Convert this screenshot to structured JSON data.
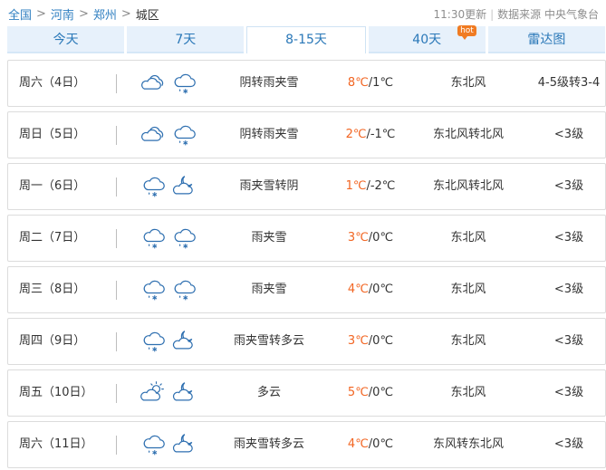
{
  "breadcrumb": {
    "items": [
      "全国",
      "河南",
      "郑州",
      "城区"
    ]
  },
  "meta": {
    "update_time": "11:30更新",
    "source": "数据来源 中央气象台"
  },
  "tabs": [
    {
      "label": "今天"
    },
    {
      "label": "7天"
    },
    {
      "label": "8-15天",
      "active": true
    },
    {
      "label": "40天",
      "badge": "hot"
    },
    {
      "label": "雷达图"
    }
  ],
  "forecast": [
    {
      "day": "周六（4日）",
      "icon_day": "cloudy-icon",
      "icon_night": "sleet-icon",
      "desc": "阴转雨夹雪",
      "hi": "8℃",
      "lo": "/1℃",
      "wind": "东北风",
      "level": "4-5级转3-4"
    },
    {
      "day": "周日（5日）",
      "icon_day": "cloudy-icon",
      "icon_night": "sleet-icon",
      "desc": "阴转雨夹雪",
      "hi": "2℃",
      "lo": "/-1℃",
      "wind": "东北风转北风",
      "level": "<3级"
    },
    {
      "day": "周一（6日）",
      "icon_day": "sleet-icon",
      "icon_night": "moon-cloud-icon",
      "desc": "雨夹雪转阴",
      "hi": "1℃",
      "lo": "/-2℃",
      "wind": "东北风转北风",
      "level": "<3级"
    },
    {
      "day": "周二（7日）",
      "icon_day": "sleet-icon",
      "icon_night": "sleet-icon",
      "desc": "雨夹雪",
      "hi": "3℃",
      "lo": "/0℃",
      "wind": "东北风",
      "level": "<3级"
    },
    {
      "day": "周三（8日）",
      "icon_day": "sleet-icon",
      "icon_night": "sleet-icon",
      "desc": "雨夹雪",
      "hi": "4℃",
      "lo": "/0℃",
      "wind": "东北风",
      "level": "<3级"
    },
    {
      "day": "周四（9日）",
      "icon_day": "sleet-icon",
      "icon_night": "moon-cloud-icon",
      "desc": "雨夹雪转多云",
      "hi": "3℃",
      "lo": "/0℃",
      "wind": "东北风",
      "level": "<3级"
    },
    {
      "day": "周五（10日）",
      "icon_day": "sun-cloud-icon",
      "icon_night": "moon-cloud-icon",
      "desc": "多云",
      "hi": "5℃",
      "lo": "/0℃",
      "wind": "东北风",
      "level": "<3级"
    },
    {
      "day": "周六（11日）",
      "icon_day": "sleet-icon",
      "icon_night": "moon-cloud-icon",
      "desc": "雨夹雪转多云",
      "hi": "4℃",
      "lo": "/0℃",
      "wind": "东风转东北风",
      "level": "<3级"
    }
  ],
  "colors": {
    "accent": "#2f7fc1",
    "high_temp": "#f26522",
    "tab_bg": "#e7f1fb"
  }
}
